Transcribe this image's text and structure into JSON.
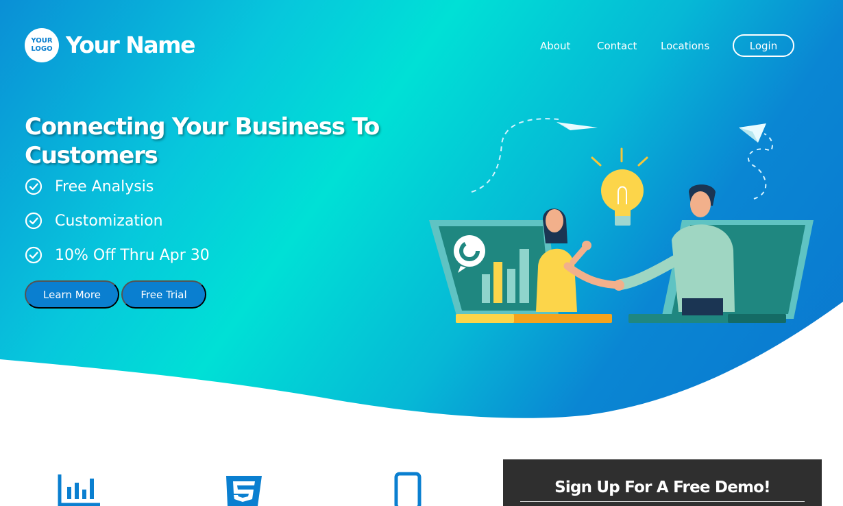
{
  "header": {
    "logo_line1": "YOUR",
    "logo_line2": "LOGO",
    "brand_name": "Your Name",
    "nav": [
      "About",
      "Contact",
      "Locations"
    ],
    "login_label": "Login"
  },
  "hero": {
    "headline_line1": "Connecting Your Business To",
    "headline_line2": "Customers",
    "features": [
      "Free Analysis",
      "Customization",
      "10% Off Thru Apr 30"
    ],
    "buttons": [
      "Learn More",
      "Free Trial"
    ]
  },
  "services": {
    "icons": [
      "bar-chart-icon",
      "css3-icon",
      "mobile-phone-icon"
    ]
  },
  "signup": {
    "title": "Sign Up For A Free Demo!"
  },
  "colors": {
    "accent": "#0a7fd0",
    "gradient_start": "#0a8fd6",
    "gradient_mid": "#00e0d6",
    "gradient_end": "#0b76cf",
    "signup_bg": "#2f2f2f"
  }
}
